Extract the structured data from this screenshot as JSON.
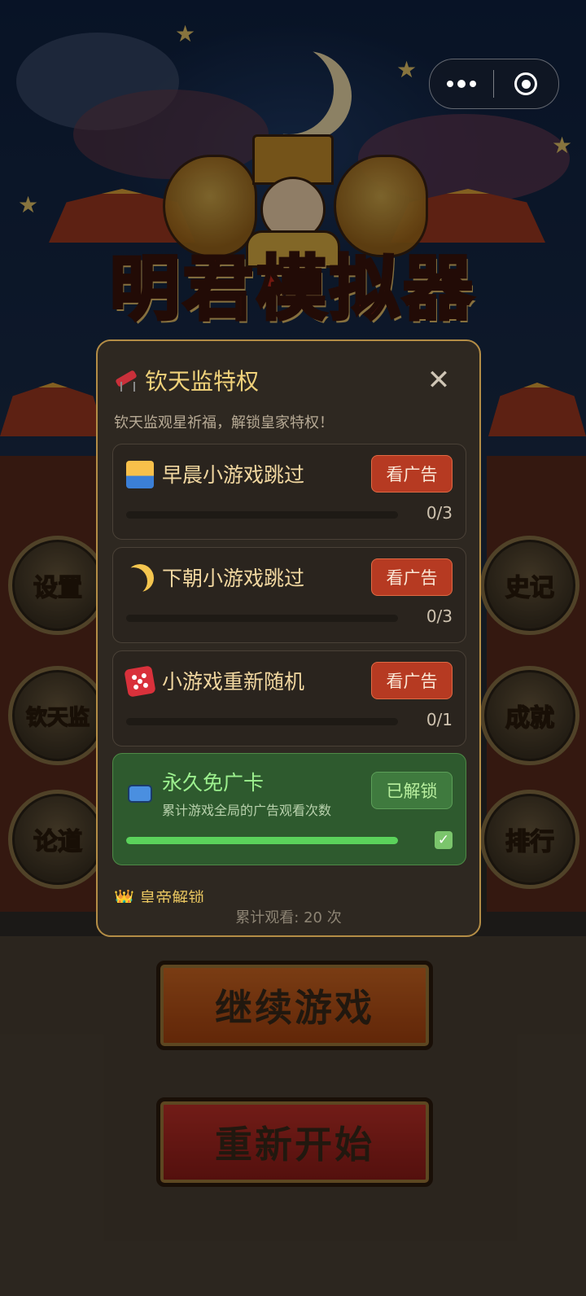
{
  "capsule": {
    "more_icon": "more-dots-icon",
    "close_icon": "target-circle-icon"
  },
  "game": {
    "title": "明君模拟器"
  },
  "side_buttons": {
    "left": [
      {
        "label": "设置",
        "icon": "gear-icon"
      },
      {
        "label": "钦天监",
        "icon": "armillary-icon"
      },
      {
        "label": "论道",
        "icon": "scroll-icon"
      }
    ],
    "right": [
      {
        "label": "史记",
        "icon": "book-icon"
      },
      {
        "label": "成就",
        "icon": "vase-icon"
      },
      {
        "label": "排行",
        "icon": "crown-icon"
      }
    ]
  },
  "main_buttons": {
    "continue": "继续游戏",
    "restart": "重新开始"
  },
  "modal": {
    "title": "钦天监特权",
    "subtitle": "钦天监观星祈福，解锁皇家特权！",
    "close_icon": "close-icon",
    "cards": [
      {
        "label": "早晨小游戏跳过",
        "icon": "sunrise-icon",
        "button": "看广告",
        "count": "0/3",
        "progress": 0
      },
      {
        "label": "下朝小游戏跳过",
        "icon": "crescent-moon-icon",
        "button": "看广告",
        "count": "0/3",
        "progress": 0
      },
      {
        "label": "小游戏重新随机",
        "icon": "dice-icon",
        "button": "看广告",
        "count": "0/1",
        "progress": 0
      }
    ],
    "premium": {
      "label": "永久免广卡",
      "desc": "累计游戏全局的广告观看次数",
      "icon": "tv-icon",
      "button": "已解锁",
      "progress": 1,
      "check_icon": "checkmark-icon"
    },
    "section_peek": "👑 皇帝解锁",
    "footer": "累计观看: 20 次"
  },
  "colors": {
    "accent_gold": "#f1d27a",
    "ad_red": "#b63a22",
    "unlocked_green": "#2e5a2e"
  }
}
